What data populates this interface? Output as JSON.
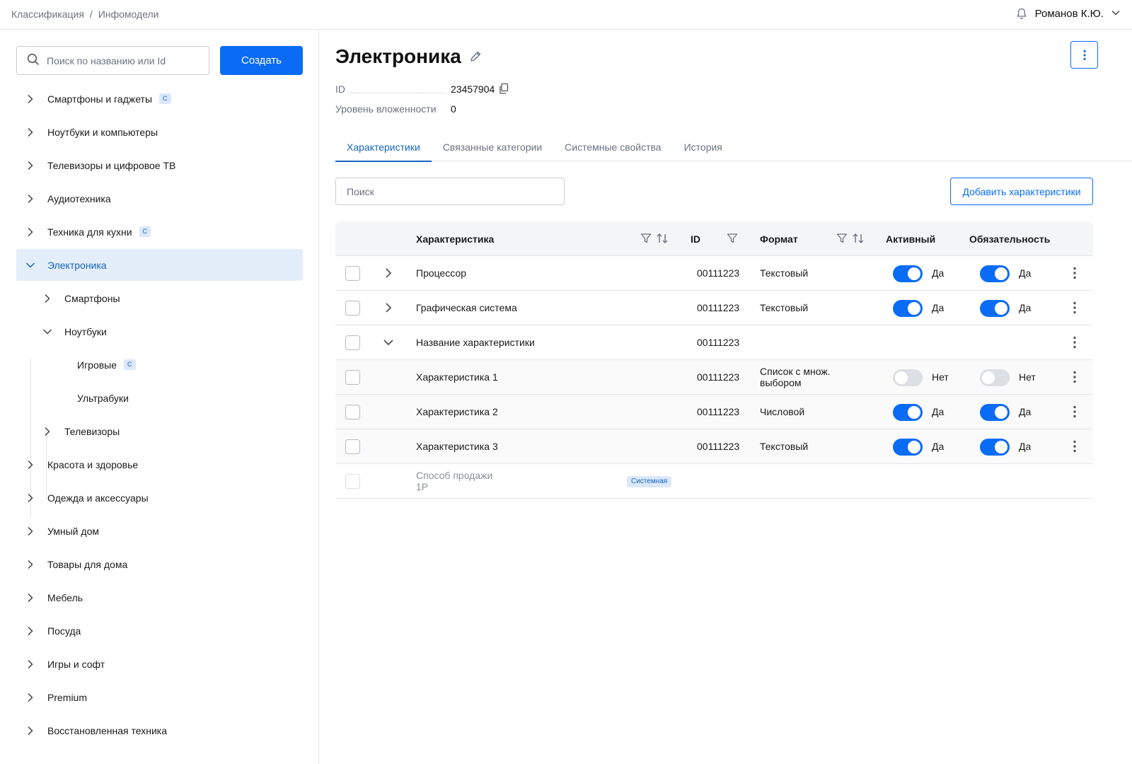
{
  "breadcrumb": [
    "Классификация",
    "Инфомодели"
  ],
  "breadcrumb_sep": "/",
  "user": {
    "name": "Романов К.Ю."
  },
  "sidebar": {
    "search_placeholder": "Поиск по названию или Id",
    "create_label": "Создать",
    "badge": "С",
    "items": [
      {
        "label": "Смартфоны и гаджеты",
        "badge": true
      },
      {
        "label": "Ноутбуки и компьютеры"
      },
      {
        "label": "Телевизоры и цифровое ТВ"
      },
      {
        "label": "Аудиотехника"
      },
      {
        "label": "Техника для кухни",
        "badge": true
      },
      {
        "label": "Электроника",
        "expanded": true,
        "selected": true
      },
      {
        "label": "Смартфоны"
      },
      {
        "label": "Ноутбуки",
        "expanded": true
      },
      {
        "label": "Игровые",
        "badge": true
      },
      {
        "label": "Ультрабуки"
      },
      {
        "label": "Телевизоры"
      },
      {
        "label": "Красота и здоровье"
      },
      {
        "label": "Одежда и аксессуары"
      },
      {
        "label": "Умный дом"
      },
      {
        "label": "Товары для дома"
      },
      {
        "label": "Мебель"
      },
      {
        "label": "Посуда"
      },
      {
        "label": "Игры и софт"
      },
      {
        "label": "Premium"
      },
      {
        "label": "Восстановленная техника"
      }
    ]
  },
  "page": {
    "title": "Электроника",
    "id_label": "ID",
    "id_value": "23457904",
    "level_label": "Уровень вложенности",
    "level_value": "0"
  },
  "tabs": [
    "Характеристики",
    "Связанные категории",
    "Системные свойства",
    "История"
  ],
  "table_search_placeholder": "Поиск",
  "add_button_label": "Добавить характеристики",
  "table": {
    "headers": {
      "name": "Характеристика",
      "id": "ID",
      "format": "Формат",
      "active": "Активный",
      "required": "Обязательность"
    },
    "rows": [
      {
        "name": "Процессор",
        "id": "00111223",
        "format": "Текстовый",
        "active": "Да",
        "required": "Да"
      },
      {
        "name": "Графическая система",
        "id": "00111223",
        "format": "Текстовый",
        "active": "Да",
        "required": "Да"
      },
      {
        "name": "Название характеристики",
        "id": "00111223"
      },
      {
        "name": "Характеристика 1",
        "id": "00111223",
        "format_line1": "Список с множ.",
        "format_line2": "выбором",
        "active": "Нет",
        "required": "Нет"
      },
      {
        "name": "Характеристика 2",
        "id": "00111223",
        "format": "Числовой",
        "active": "Да",
        "required": "Да"
      },
      {
        "name": "Характеристика 3",
        "id": "00111223",
        "format": "Текстовый",
        "active": "Да",
        "required": "Да"
      },
      {
        "name_line1": "Способ продажи",
        "name_line2": "1P",
        "badge": "Системная"
      }
    ]
  }
}
